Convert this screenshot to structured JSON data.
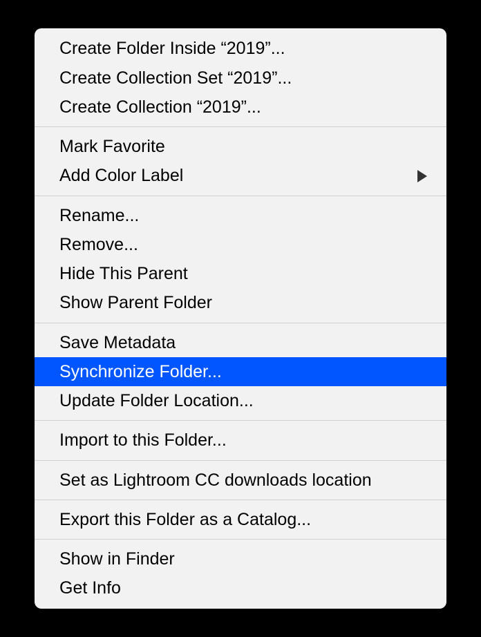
{
  "menu": {
    "groups": [
      [
        {
          "label": "Create Folder Inside “2019”...",
          "submenu": false,
          "highlighted": false
        },
        {
          "label": "Create Collection Set “2019”...",
          "submenu": false,
          "highlighted": false
        },
        {
          "label": "Create Collection “2019”...",
          "submenu": false,
          "highlighted": false
        }
      ],
      [
        {
          "label": "Mark Favorite",
          "submenu": false,
          "highlighted": false
        },
        {
          "label": "Add Color Label",
          "submenu": true,
          "highlighted": false
        }
      ],
      [
        {
          "label": "Rename...",
          "submenu": false,
          "highlighted": false
        },
        {
          "label": "Remove...",
          "submenu": false,
          "highlighted": false
        },
        {
          "label": "Hide This Parent",
          "submenu": false,
          "highlighted": false
        },
        {
          "label": "Show Parent Folder",
          "submenu": false,
          "highlighted": false
        }
      ],
      [
        {
          "label": "Save Metadata",
          "submenu": false,
          "highlighted": false
        },
        {
          "label": "Synchronize Folder...",
          "submenu": false,
          "highlighted": true
        },
        {
          "label": "Update Folder Location...",
          "submenu": false,
          "highlighted": false
        }
      ],
      [
        {
          "label": "Import to this Folder...",
          "submenu": false,
          "highlighted": false
        }
      ],
      [
        {
          "label": "Set as Lightroom CC downloads location",
          "submenu": false,
          "highlighted": false
        }
      ],
      [
        {
          "label": "Export this Folder as a Catalog...",
          "submenu": false,
          "highlighted": false
        }
      ],
      [
        {
          "label": "Show in Finder",
          "submenu": false,
          "highlighted": false
        },
        {
          "label": "Get Info",
          "submenu": false,
          "highlighted": false
        }
      ]
    ]
  }
}
